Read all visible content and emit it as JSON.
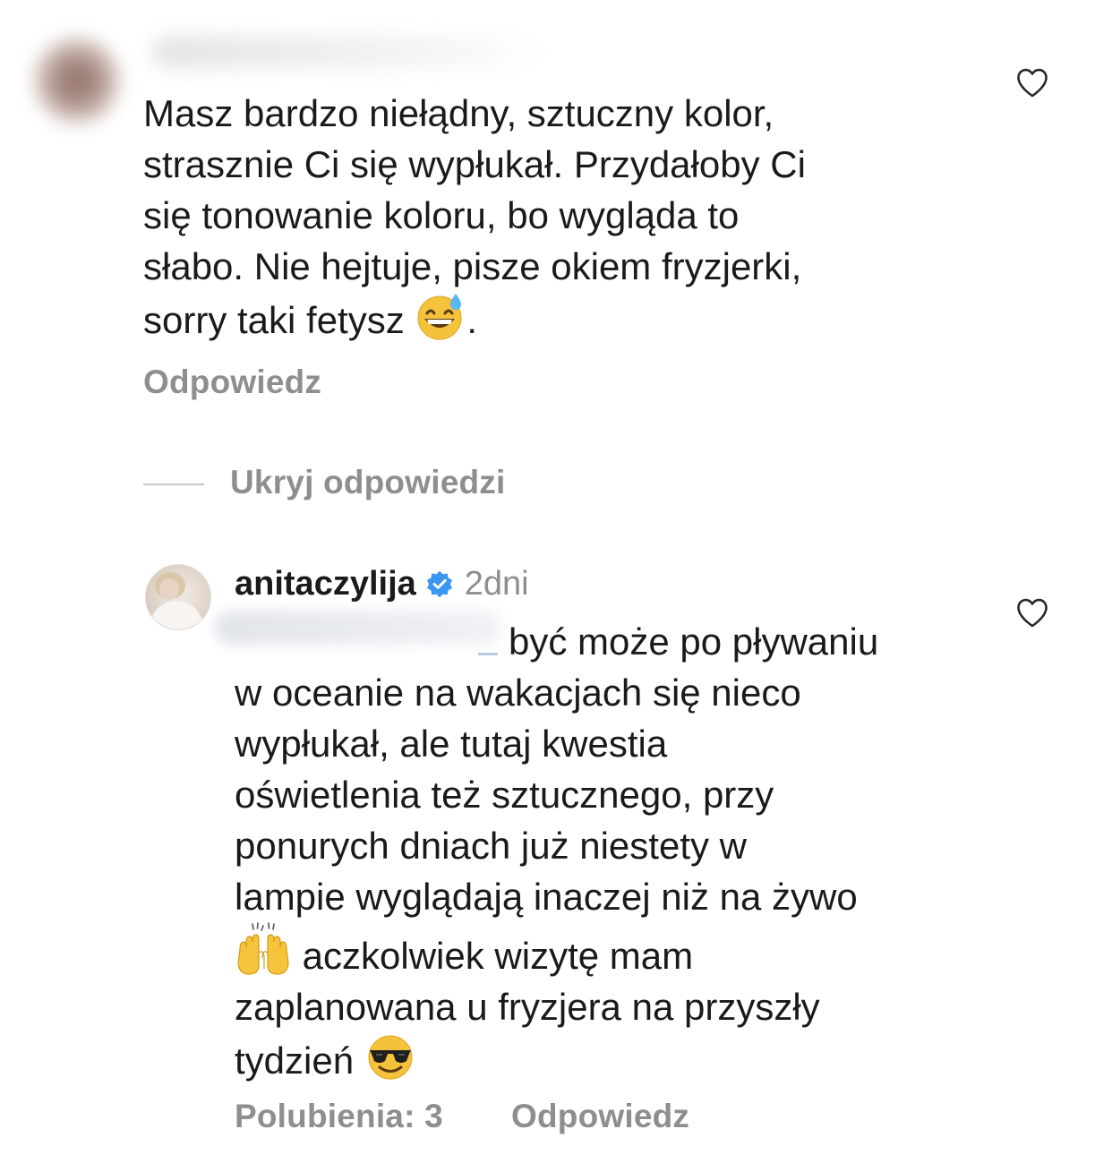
{
  "comment": {
    "text_lines": [
      "Masz bardzo niełądny, sztuczny kolor,",
      "strasznie Ci się wypłukał. Przydałoby Ci",
      "się tonowanie koloru, bo wygląda to",
      "słabo. Nie hejtuje, pisze okiem fryzjerki,"
    ],
    "text_last_prefix": "sorry taki fetysz ",
    "text_last_suffix": ".",
    "emoji": "grinning-face-with-sweat",
    "reply_label": "Odpowiedz"
  },
  "replies_toggle": {
    "label": "Ukryj odpowiedzi"
  },
  "reply": {
    "username": "anitaczylija",
    "verified": true,
    "time": "2dni",
    "line1": "być może po pływaniu",
    "lines_middle": [
      "w oceanie na wakacjach się nieco",
      "wypłukał, ale tutaj kwestia",
      "oświetlenia też sztucznego, przy",
      "ponurych dniach już niestety w",
      "lampie wyglądają inaczej niż na żywo"
    ],
    "raised_hands_suffix": " aczkolwiek wizytę mam",
    "line_after": "zaplanowana u fryzjera na przyszły",
    "last_prefix": "tydzień ",
    "emoji_hands": "raising-hands",
    "emoji_sunglasses": "smiling-face-with-sunglasses",
    "likes_label": "Polubienia: 3",
    "reply_label": "Odpowiedz"
  },
  "colors": {
    "text": "#1a1a1a",
    "secondary": "#8e8e8e",
    "verified_blue": "#3897f0"
  }
}
